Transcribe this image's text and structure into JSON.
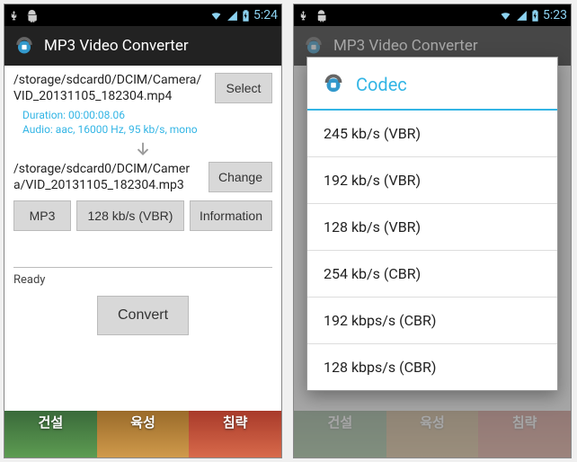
{
  "status": {
    "time_left": "5:24",
    "time_right": "5:23"
  },
  "app": {
    "title": "MP3 Video Converter"
  },
  "left": {
    "source_path": "/storage/sdcard0/DCIM/Camera/VID_20131105_182304.mp4",
    "select_label": "Select",
    "meta_line1": "Duration: 00:00:08.06",
    "meta_line2": "Audio: aac, 16000 Hz, 95 kb/s, mono",
    "dest_path": "/storage/sdcard0/DCIM/Camera/VID_20131105_182304.mp3",
    "change_label": "Change",
    "format_label": "MP3",
    "bitrate_label": "128  kb/s (VBR)",
    "info_label": "Information",
    "status_text": "Ready",
    "convert_label": "Convert"
  },
  "ad": {
    "c1": "건설",
    "c2": "육성",
    "c3": "침략"
  },
  "dialog": {
    "title": "Codec",
    "options": [
      "245 kb/s (VBR)",
      "192  kb/s (VBR)",
      "128  kb/s (VBR)",
      "254 kb/s (CBR)",
      "192 kbps/s (CBR)",
      "128 kbps/s (CBR)"
    ]
  }
}
